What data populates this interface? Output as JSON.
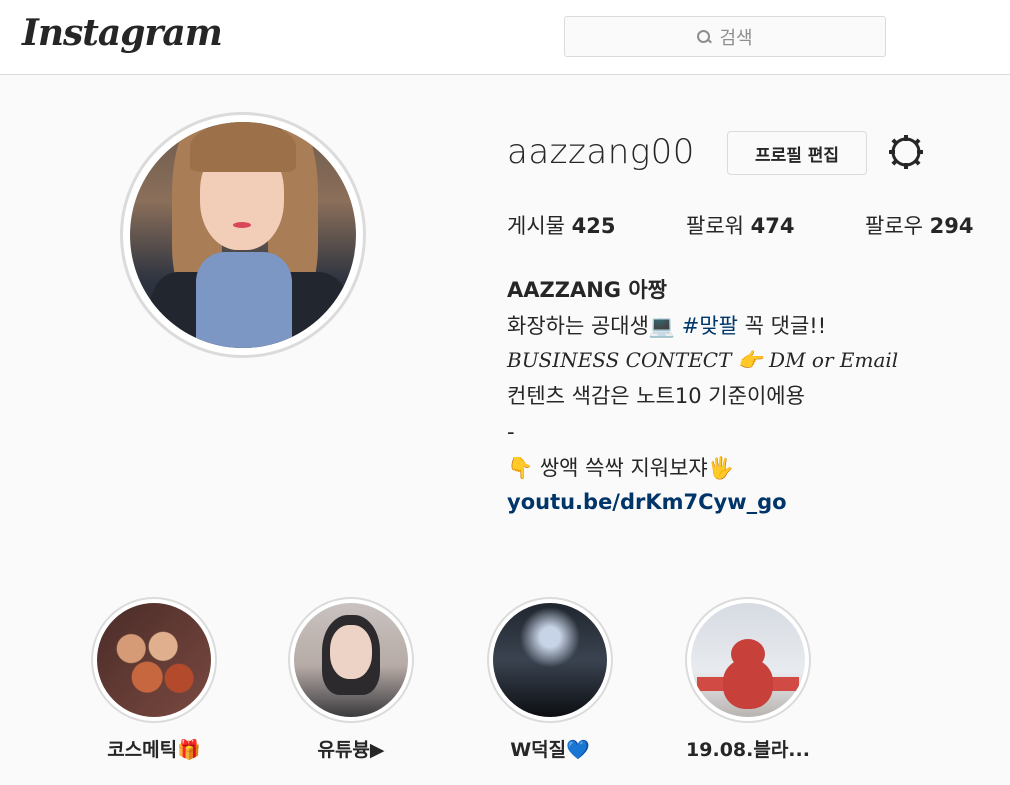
{
  "header": {
    "logo_text": "Instagram",
    "search_placeholder": "검색"
  },
  "profile": {
    "username": "aazzang00",
    "edit_label": "프로필 편집",
    "stats": {
      "posts_label": "게시물",
      "posts_count": "425",
      "followers_label": "팔로워",
      "followers_count": "474",
      "following_label": "팔로우",
      "following_count": "294"
    },
    "bio": {
      "name": "AAZZANG 아짱",
      "line1_prefix": "화장하는 공대생💻 ",
      "line1_hashtag": "#맞팔",
      "line1_suffix": " 꼭 댓글!!",
      "line2": "BUSINESS CONTECT 👉 DM or Email",
      "line3": "컨텐츠 색감은 노트10 기준이에용",
      "line4": "-",
      "line5": "👇 쌍액 쓱싹 지워보쟈🖐",
      "link": "youtu.be/drKm7Cyw_go"
    }
  },
  "highlights": [
    {
      "label": "코스메틱🎁"
    },
    {
      "label": "유튜븅▶"
    },
    {
      "label": "W덕질💙"
    },
    {
      "label": "19.08.블라..."
    }
  ]
}
